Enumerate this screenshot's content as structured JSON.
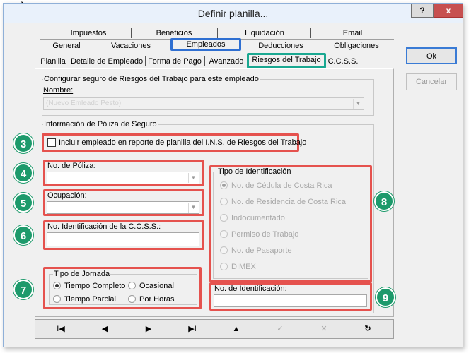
{
  "window": {
    "title": "Definir planilla..."
  },
  "titlebar": {
    "help": "?",
    "close": "x"
  },
  "tabs_row1": [
    "Impuestos",
    "Beneficios",
    "Liquidación",
    "Email"
  ],
  "tabs_row2": [
    "General",
    "Vacaciones",
    "Empleados",
    "Deducciones",
    "Obligaciones"
  ],
  "tabs_row3": [
    "Planilla",
    "Detalle de Empleado",
    "Forma de Pago",
    "Avanzado",
    "Riesgos del Trabajo",
    "C.C.S.S."
  ],
  "config": {
    "title": "Configurar seguro de Riesgos del Trabajo para este empleado",
    "name_label": "Nombre:",
    "name_value": "(Nuevo Emleado Pesto)"
  },
  "poliza": {
    "title": "Información de Póliza de Seguro",
    "include_label": "Incluir empleado en reporte de planilla del I.N.S. de Riesgos del Trabajo",
    "no_poliza_label": "No. de Póliza:",
    "ocupacion_label": "Ocupación:",
    "ccss_label": "No. Identificación de la C.C.S.S.:"
  },
  "jornada": {
    "title": "Tipo de Jornada",
    "options": [
      "Tiempo Completo",
      "Ocasional",
      "Tiempo Parcial",
      "Por Horas"
    ],
    "selected": "Tiempo Completo"
  },
  "identificacion": {
    "title": "Tipo de Identificación",
    "options": [
      "No. de Cédula de Costa Rica",
      "No. de Residencia de Costa Rica",
      "Indocumentado",
      "Permiso de Trabajo",
      "No. de Pasaporte",
      "DIMEX"
    ],
    "selected": "No. de Cédula de Costa Rica",
    "number_label": "No. de Identificación:"
  },
  "buttons": {
    "ok": "Ok",
    "cancel": "Cancelar"
  },
  "badges": [
    "3",
    "4",
    "5",
    "6",
    "7",
    "8",
    "9"
  ],
  "nav": {
    "first": "I◀",
    "prev": "◀",
    "next": "▶",
    "last": "▶I",
    "up": "▲",
    "check": "✓",
    "x": "✕",
    "refresh": "↻"
  }
}
